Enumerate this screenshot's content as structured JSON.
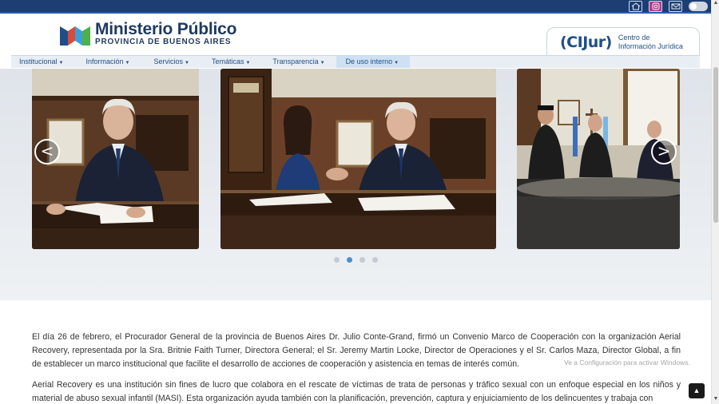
{
  "top_icons": [
    "home-icon",
    "instagram-icon",
    "mail-icon",
    "theme-toggle"
  ],
  "header": {
    "logo_title": "Ministerio Público",
    "logo_subtitle": "PROVINCIA DE BUENOS AIRES",
    "cijur_mark": "(CIJur)",
    "cijur_line1": "Centro de",
    "cijur_line2": "Información Jurídica"
  },
  "nav": [
    {
      "label": "Institucional"
    },
    {
      "label": "Información"
    },
    {
      "label": "Servicios"
    },
    {
      "label": "Temáticas"
    },
    {
      "label": "Transparencia"
    },
    {
      "label": "De uso interno"
    }
  ],
  "carousel": {
    "prev": "<",
    "next": ">",
    "dots": 4,
    "active_dot": 1
  },
  "article": {
    "p1": "El día 26 de febrero, el Procurador General de la provincia de Buenos Aires Dr. Julio Conte-Grand, firmó un Convenio Marco de Cooperación con la organización Aerial Recovery, representada por la Sra. Britnie Faith Turner, Directora General; el Sr. Jeremy Martin Locke, Director de Operaciones y el Sr. Carlos Maza, Director Global, a fin de establecer un marco institucional que facilite el desarrollo de acciones de cooperación y asistencia en temas de interés común.",
    "p2": "Aerial Recovery es una institución sin fines de lucro que colabora en el rescate de víctimas de trata de personas y tráfico sexual con un enfoque especial en los niños y material de abuso sexual infantil (MASI). Esta organización ayuda también con la planificación, prevención, captura y enjuiciamiento de los delincuentes y trabaja con"
  },
  "watermark": "Ve a Configuración para activar Windows.",
  "colors": {
    "topbar": "#1c3e72",
    "brand_blue": "#1f4f86",
    "nav_bg": "#e9eef5",
    "dot_active": "#4a90c8"
  }
}
